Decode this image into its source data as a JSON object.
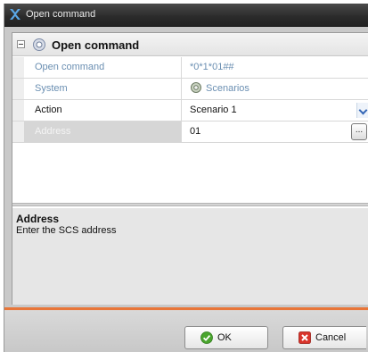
{
  "window": {
    "title": "Open command",
    "title_icon": "app-logo-icon"
  },
  "section": {
    "title": "Open command",
    "icon": "settings-gear-icon"
  },
  "properties": [
    {
      "label": "Open command",
      "value": "*0*1*01##"
    },
    {
      "label": "System",
      "value": "Scenarios",
      "icon": "scenarios-icon"
    },
    {
      "label": "Action",
      "value": "Scenario 1",
      "control": "dropdown"
    },
    {
      "label": "Address",
      "value": "01",
      "control": "browse",
      "browse_label": "..."
    }
  ],
  "help": {
    "title": "Address",
    "text": "Enter the SCS address"
  },
  "buttons": {
    "ok": "OK",
    "cancel": "Cancel"
  },
  "colors": {
    "accent": "#e8763a",
    "readonly_text": "#6b8fb2",
    "title_bar": "#2a2a2a"
  }
}
